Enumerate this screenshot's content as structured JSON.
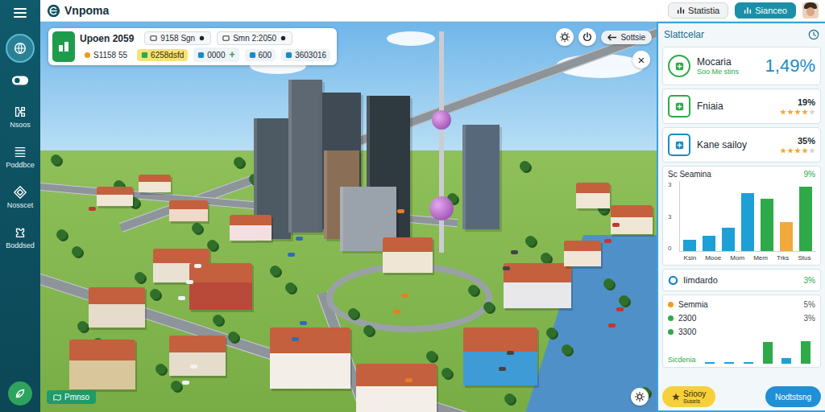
{
  "app": {
    "logo": "Vnpoma"
  },
  "header_buttons": [
    {
      "label": "Statistia",
      "primary": false
    },
    {
      "label": "Sianceo",
      "primary": true
    }
  ],
  "sidebar": {
    "top_icons": [
      {
        "selected": true
      },
      {
        "selected": false
      }
    ],
    "items": [
      {
        "label": "Nsoos",
        "selected": false
      },
      {
        "label": "Poddbce",
        "selected": false
      },
      {
        "label": "Nosscet",
        "selected": false
      },
      {
        "label": "Boddsed",
        "selected": false
      }
    ]
  },
  "hud": {
    "title": "Upoen 2059",
    "top_stats": [
      "9158 Sgn",
      "Smn 2:2050"
    ],
    "bottom_stats": [
      {
        "text": "S1158 55",
        "kind": "coin"
      },
      {
        "text": "6258dsfd",
        "kind": "highlight"
      },
      {
        "text": "0000",
        "kind": "plus",
        "suffix": "+"
      },
      {
        "text": "600",
        "kind": "plain"
      },
      {
        "text": "3603016",
        "kind": "plain"
      }
    ]
  },
  "scene_controls": {
    "back_button": "Sottsie",
    "close": "×",
    "map_button": "Pmnso"
  },
  "panel": {
    "title": "Slattcelar",
    "cards": [
      {
        "kind": "big",
        "title": "Mocaria",
        "subtitle": "Soo Me stins",
        "value": "1,49%",
        "color": "#2eaa4a"
      },
      {
        "kind": "rated",
        "title": "Fniaia",
        "value": "19%",
        "stars": 4,
        "color": "#2eaa4a"
      },
      {
        "kind": "rated",
        "title": "Kane sailoy",
        "value": "35%",
        "stars": 4,
        "color": "#1a8bc5"
      }
    ],
    "chart": {
      "title": "Sc Seamina",
      "value": "9%",
      "y_ticks": [
        "3",
        "3",
        "0"
      ],
      "x_labels": [
        "Ksin",
        "Mooe",
        "Mom",
        "Mem",
        "Trks",
        "Stus"
      ],
      "max": 12,
      "bars": [
        {
          "value": 2,
          "color": "#1e9fd6"
        },
        {
          "value": 2.6,
          "color": "#1e9fd6"
        },
        {
          "value": 4,
          "color": "#1e9fd6"
        },
        {
          "value": 10,
          "color": "#1e9fd6"
        },
        {
          "value": 9,
          "color": "#2eaa4a"
        },
        {
          "value": 5,
          "color": "#f2a93b"
        },
        {
          "value": 11,
          "color": "#2eaa4a"
        }
      ]
    },
    "metric": {
      "label": "Iimdardo",
      "value": "3%"
    },
    "legend": [
      {
        "label": "Semmia",
        "value": "5%",
        "color": "#f29b1d"
      },
      {
        "label": "2300",
        "value": "3%",
        "color": "#2eaa4a"
      },
      {
        "label": "3300",
        "color": "#2eaa4a"
      }
    ],
    "legend_footer": "Sicdenia",
    "mini_chart": {
      "max": 10,
      "bars": [
        {
          "value": 0.8,
          "color": "#1e9fd6"
        },
        {
          "value": 0.8,
          "color": "#1e9fd6"
        },
        {
          "value": 0.8,
          "color": "#1e9fd6"
        },
        {
          "value": 9,
          "color": "#2eaa4a"
        },
        {
          "value": 2.5,
          "color": "#1e9fd6"
        },
        {
          "value": 9.5,
          "color": "#2eaa4a"
        }
      ]
    }
  },
  "footer_buttons": [
    {
      "label": "Sriooy",
      "sublabel": "Susels",
      "kind": "yellow"
    },
    {
      "label": "Nodtstsng",
      "kind": "blue"
    }
  ]
}
